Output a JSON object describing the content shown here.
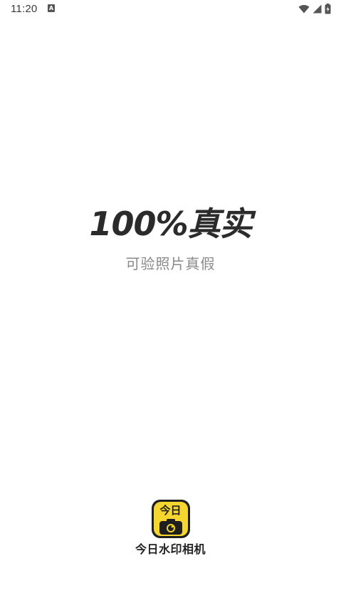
{
  "status_bar": {
    "time": "11:20",
    "notification_icon": "A"
  },
  "splash": {
    "headline": "100%真实",
    "subline": "可验照片真假"
  },
  "brand": {
    "icon_text": "今日",
    "name": "今日水印相机",
    "accent_color": "#f5d62e"
  }
}
